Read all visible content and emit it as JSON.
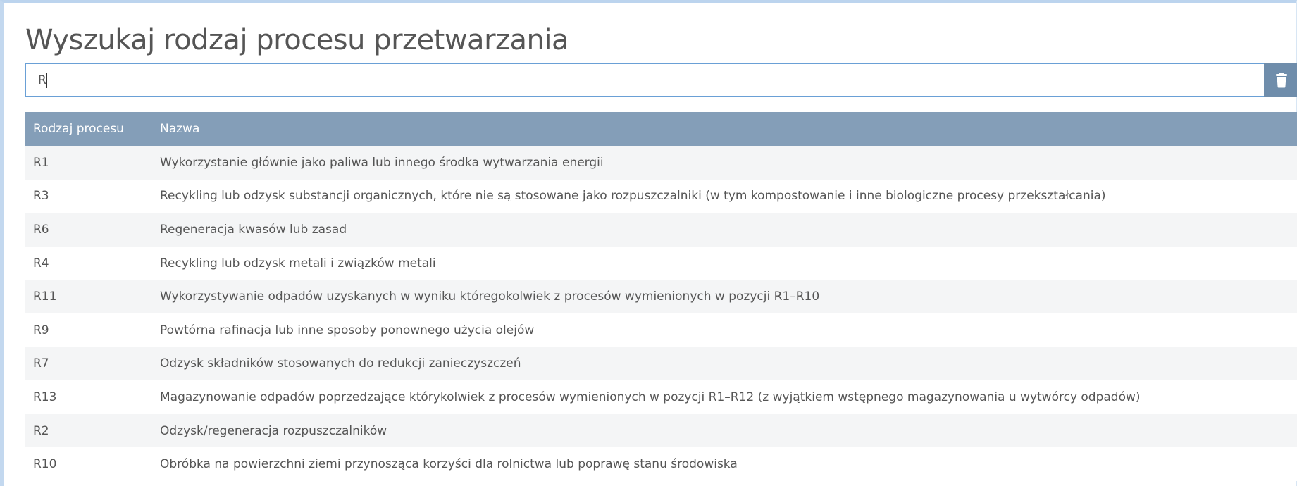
{
  "page": {
    "title": "Wyszukaj rodzaj procesu przetwarzania"
  },
  "search": {
    "value": "R",
    "clear_icon": "trash-icon"
  },
  "colors": {
    "header_bg": "#849eb8",
    "clear_button_bg": "#6f8dab",
    "input_border": "#6aa0d6",
    "row_stripe": "#f4f5f6"
  },
  "table": {
    "headers": [
      "Rodzaj procesu",
      "Nazwa"
    ],
    "rows": [
      {
        "code": "R1",
        "name": "Wykorzystanie głównie jako paliwa lub innego środka wytwarzania energii"
      },
      {
        "code": "R3",
        "name": "Recykling lub odzysk substancji organicznych, które nie są stosowane jako rozpuszczalniki (w tym kompostowanie i inne biologiczne procesy przekształcania)"
      },
      {
        "code": "R6",
        "name": "Regeneracja kwasów lub zasad"
      },
      {
        "code": "R4",
        "name": "Recykling lub odzysk metali i związków metali"
      },
      {
        "code": "R11",
        "name": "Wykorzystywanie odpadów uzyskanych w wyniku któregokolwiek z procesów wymienionych w pozycji R1–R10"
      },
      {
        "code": "R9",
        "name": "Powtórna rafinacja lub inne sposoby ponownego użycia olejów"
      },
      {
        "code": "R7",
        "name": "Odzysk składników stosowanych do redukcji zanieczyszczeń"
      },
      {
        "code": "R13",
        "name": "Magazynowanie odpadów poprzedzające którykolwiek z procesów wymienionych w pozycji R1–R12 (z wyjątkiem wstępnego magazynowania u wytwórcy odpadów)"
      },
      {
        "code": "R2",
        "name": "Odzysk/regeneracja rozpuszczalników"
      },
      {
        "code": "R10",
        "name": "Obróbka na powierzchni ziemi przynosząca korzyści dla rolnictwa lub poprawę stanu środowiska"
      }
    ]
  }
}
